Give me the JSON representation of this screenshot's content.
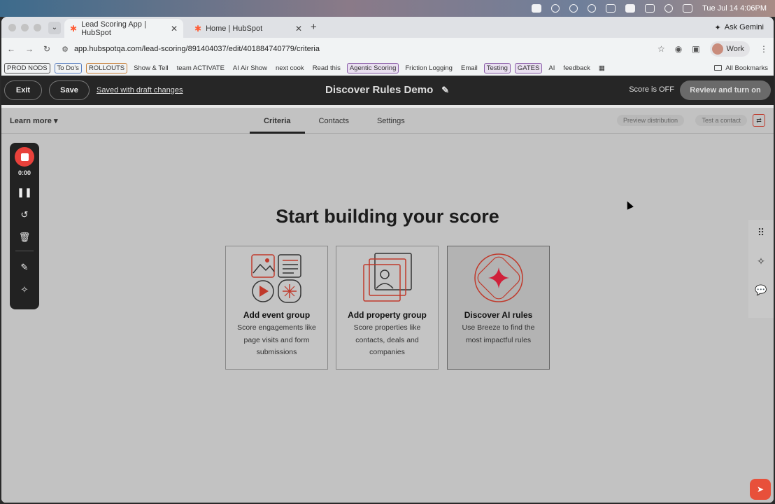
{
  "menubar": {
    "datetime": "Tue Jul 14  4:06PM"
  },
  "browser": {
    "tabs": [
      {
        "title": "Lead Scoring App | HubSpot"
      },
      {
        "title": "Home | HubSpot"
      }
    ],
    "gemini_label": "Ask Gemini",
    "url": "app.hubspotqa.com/lead-scoring/891404037/edit/401884740779/criteria",
    "profile_label": "Work",
    "bookmarks": [
      "PROD NODS",
      "To Do's",
      "ROLLOUTS",
      "Show & Tell",
      "team ACTIVATE",
      "AI Air Show",
      "next cook",
      "Read this",
      "Agentic Scoring",
      "Friction Logging",
      "Email",
      "Testing",
      "GATES",
      "AI",
      "feedback"
    ],
    "all_bookmarks": "All Bookmarks"
  },
  "header": {
    "exit": "Exit",
    "save": "Save",
    "saved_status": "Saved with draft changes",
    "title": "Discover Rules Demo",
    "score_status": "Score is OFF",
    "review": "Review and turn on"
  },
  "subnav": {
    "learn_more": "Learn more",
    "tabs": [
      "Criteria",
      "Contacts",
      "Settings"
    ],
    "preview": "Preview distribution",
    "test": "Test a contact"
  },
  "recorder": {
    "time": "0:00"
  },
  "main": {
    "heading": "Start building your score",
    "cards": [
      {
        "title": "Add event group",
        "desc": "Score engagements like page visits and form submissions"
      },
      {
        "title": "Add property group",
        "desc": "Score properties like contacts, deals and companies"
      },
      {
        "title": "Discover AI rules",
        "desc": "Use Breeze to find the most impactful rules"
      }
    ]
  },
  "colors": {
    "accent": "#e8413b",
    "header_bg": "#262626",
    "overlay_bg": "#c2c2c2"
  }
}
